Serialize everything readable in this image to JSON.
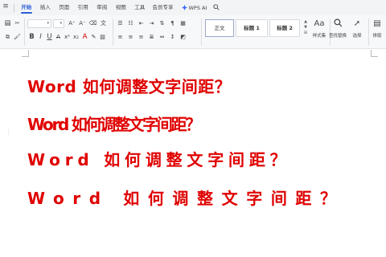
{
  "ribbon": {
    "menu_icon": "≡",
    "tabs": [
      {
        "label": "开始",
        "active": true
      },
      {
        "label": "插入"
      },
      {
        "label": "页面"
      },
      {
        "label": "引用"
      },
      {
        "label": "审阅"
      },
      {
        "label": "视图"
      },
      {
        "label": "工具"
      },
      {
        "label": "会员专享"
      }
    ],
    "wps_ai_label": "WPS AI",
    "search_icon": "search-icon"
  },
  "toolbar": {
    "font_name": "",
    "font_size": "",
    "styles": [
      {
        "label": "正文",
        "selected": true
      },
      {
        "label": "标题 1"
      },
      {
        "label": "标题 2"
      }
    ],
    "style_set_label": "样式集",
    "find_replace_label": "查找替换",
    "select_label": "选择",
    "arrange_label": "排版"
  },
  "document": {
    "lines": [
      "Word 如何调整文字间距？",
      "Word 如何调整文字间距？",
      "Word 如何调整文字间距？",
      "Word 如何调整文字间距？"
    ],
    "text_color": "#e00000"
  },
  "colors": {
    "accent": "#2b5fd9",
    "ribbon_bg": "#f3f4f6",
    "toolbar_bg": "#f7f8fa"
  }
}
